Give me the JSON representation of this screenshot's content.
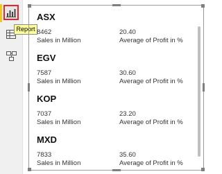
{
  "sidebar": {
    "items": [
      {
        "icon": "report-view-icon",
        "active": true
      },
      {
        "icon": "data-view-icon",
        "active": false
      },
      {
        "icon": "model-view-icon",
        "active": false
      }
    ],
    "tooltip": "Report",
    "highlight_color": "#e8242d"
  },
  "cards": [
    {
      "title": "ASX",
      "sales": "8462",
      "profit": "20.40",
      "sales_label": "Sales in Million",
      "profit_label": "Average of Profit in %"
    },
    {
      "title": "EGV",
      "sales": "7587",
      "profit": "30.60",
      "sales_label": "Sales in Million",
      "profit_label": "Average of Profit in %"
    },
    {
      "title": "KOP",
      "sales": "7037",
      "profit": "23.20",
      "sales_label": "Sales in Million",
      "profit_label": "Average of Profit in %"
    },
    {
      "title": "MXD",
      "sales": "7833",
      "profit": "35.60",
      "sales_label": "Sales in Million",
      "profit_label": "Average of Profit in %"
    }
  ]
}
